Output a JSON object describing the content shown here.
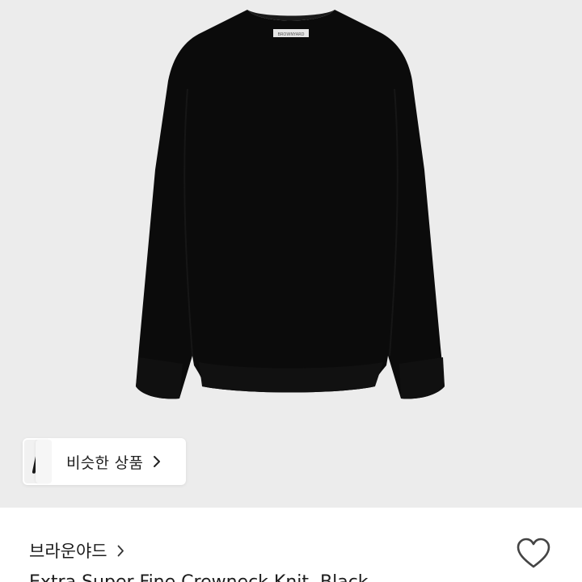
{
  "product_image": {
    "alt": "black crewneck knit sweater",
    "tag_text": "BROWNYARD"
  },
  "similar_items": {
    "label": "비슷한 상품",
    "icon": "chevron-right-icon"
  },
  "brand": {
    "name": "브라운야드",
    "icon": "chevron-right-icon"
  },
  "like": {
    "icon": "heart-outline-icon",
    "color": "#444444"
  },
  "product": {
    "title": "Extra Super Fine Crewneck Knit, Black"
  },
  "colors": {
    "image_bg": "#ececec",
    "sweater": "#0b0b0b"
  }
}
